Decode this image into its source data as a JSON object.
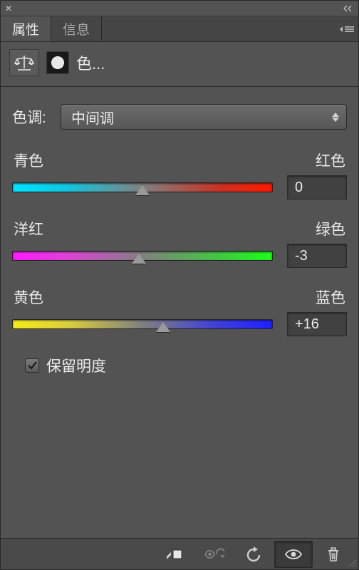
{
  "tabs": {
    "properties": "属性",
    "info": "信息"
  },
  "adjustment": {
    "title": "色..."
  },
  "tone": {
    "label": "色调:",
    "value": "中间调"
  },
  "sliders": {
    "cyan_red": {
      "left": "青色",
      "right": "红色",
      "value": "0",
      "pct": 50
    },
    "magenta_green": {
      "left": "洋红",
      "right": "绿色",
      "value": "-3",
      "pct": 48.5
    },
    "yellow_blue": {
      "left": "黄色",
      "right": "蓝色",
      "value": "+16",
      "pct": 58
    }
  },
  "preserve": {
    "label": "保留明度",
    "checked": true
  }
}
